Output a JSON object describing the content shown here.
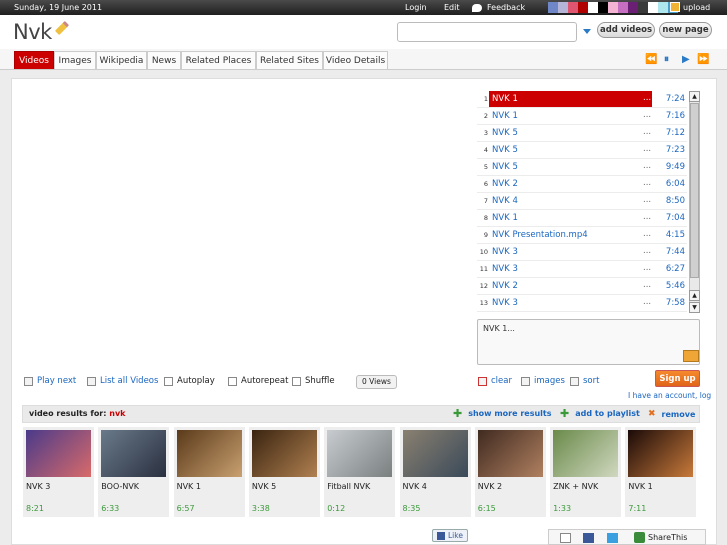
{
  "topbar": {
    "date": "Sunday, 19 June 2011",
    "login": "Login",
    "edit": "Edit",
    "feedback": "Feedback",
    "upload": "upload",
    "swatches": [
      "#6f86c7",
      "#b5b5d8",
      "#e05670",
      "#b00000",
      "#ffffff",
      "#000000",
      "#f5b3d3",
      "#c66ec0",
      "#6a1e74",
      "#3a3a3a",
      "#ffffff",
      "#aee6ee",
      "#4ca0c8"
    ]
  },
  "header": {
    "logo": "Nvk",
    "search_value": "",
    "add_videos": "add videos",
    "new_page": "new page"
  },
  "tabs": [
    "Videos",
    "Images",
    "Wikipedia",
    "News",
    "Related Places",
    "Related Sites",
    "Video Details"
  ],
  "player_controls": {
    "rewind": "⏪",
    "pause": "⏸",
    "play": "▶",
    "forward": "⏩"
  },
  "playlist": [
    {
      "num": "1",
      "title": "NVK 1",
      "dots": "...",
      "time": "7:24"
    },
    {
      "num": "2",
      "title": "NVK 1",
      "dots": "...",
      "time": "7:16"
    },
    {
      "num": "3",
      "title": "NVK 5",
      "dots": "...",
      "time": "7:12"
    },
    {
      "num": "4",
      "title": "NVK 5",
      "dots": "...",
      "time": "7:23"
    },
    {
      "num": "5",
      "title": "NVK 5",
      "dots": "...",
      "time": "9:49"
    },
    {
      "num": "6",
      "title": "NVK 2",
      "dots": "...",
      "time": "6:04"
    },
    {
      "num": "7",
      "title": "NVK 4",
      "dots": "...",
      "time": "8:50"
    },
    {
      "num": "8",
      "title": "NVK 1",
      "dots": "...",
      "time": "7:04"
    },
    {
      "num": "9",
      "title": "NVK Presentation.mp4",
      "dots": "...",
      "time": "4:15"
    },
    {
      "num": "10",
      "title": "NVK 3",
      "dots": "...",
      "time": "7:44"
    },
    {
      "num": "11",
      "title": "NVK 3",
      "dots": "...",
      "time": "6:27"
    },
    {
      "num": "12",
      "title": "NVK 2",
      "dots": "...",
      "time": "5:46"
    },
    {
      "num": "13",
      "title": "NVK 3",
      "dots": "...",
      "time": "7:58"
    }
  ],
  "description": "NVK 1...",
  "controls": {
    "play_next": "Play next",
    "list_all": "List all Videos",
    "autoplay": "Autoplay",
    "autorepeat": "Autorepeat",
    "shuffle": "Shuffle",
    "views": "0 Views",
    "clear": "clear",
    "images": "images",
    "sort": "sort",
    "signup": "Sign up",
    "have_account": "I have an account, log"
  },
  "results": {
    "label": "video results for:",
    "query": "nvk",
    "show_more": "show more results",
    "add_playlist": "add to playlist",
    "remove": "remove"
  },
  "thumbnails": [
    {
      "title": "NVK 3",
      "duration": "8:21",
      "c1": "#4a3a8a",
      "c2": "#d86a6a"
    },
    {
      "title": "BOO-NVK",
      "duration": "6:33",
      "c1": "#6a7a8a",
      "c2": "#2a3040"
    },
    {
      "title": "NVK 1",
      "duration": "6:57",
      "c1": "#5a3a1a",
      "c2": "#c9a070"
    },
    {
      "title": "NVK 5",
      "duration": "3:38",
      "c1": "#3a2410",
      "c2": "#b08050"
    },
    {
      "title": "Fitball NVK",
      "duration": "0:12",
      "c1": "#c8ccd0",
      "c2": "#7a8080"
    },
    {
      "title": "NVK 4",
      "duration": "8:35",
      "c1": "#8a8070",
      "c2": "#3a4a5a"
    },
    {
      "title": "NVK 2",
      "duration": "6:15",
      "c1": "#402a20",
      "c2": "#b08060"
    },
    {
      "title": "ZNK + NVK",
      "duration": "1:33",
      "c1": "#6a8a4a",
      "c2": "#d0d8c0"
    },
    {
      "title": "NVK 1",
      "duration": "7:11",
      "c1": "#1a0a08",
      "c2": "#c87a3a"
    }
  ],
  "social": {
    "like": "Like",
    "sharethis": "ShareThis"
  }
}
